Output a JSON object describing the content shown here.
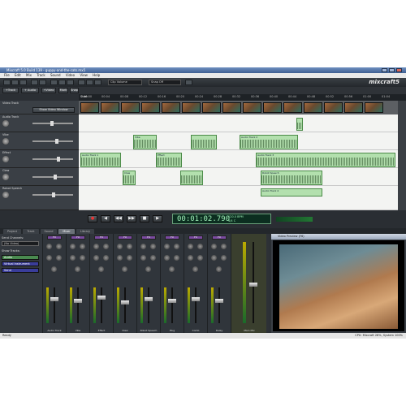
{
  "window": {
    "title": "Mixcraft 5.0 Build 139 - guppy-and-the-cats.mx5"
  },
  "menu": [
    "File",
    "Edit",
    "Mix",
    "Track",
    "Sound",
    "Video",
    "View",
    "Help"
  ],
  "toolbar": {
    "preset_combo": "Clip Volume",
    "snap_combo": "Snap Off",
    "logo": "mixcraft5"
  },
  "subtoolbar": {
    "buttons": [
      "+Track",
      "+ Audio",
      "+Video",
      "Mark",
      "Snap"
    ]
  },
  "ruler": {
    "labels": [
      "00:00",
      "00:04",
      "00:08",
      "00:12",
      "00:16",
      "00:20",
      "00:24",
      "00:28",
      "00:32",
      "00:36",
      "00:40",
      "00:44",
      "00:48",
      "00:52",
      "00:56",
      "01:00",
      "01:04"
    ],
    "marker": "Start"
  },
  "tracks": [
    {
      "name": "Video Track",
      "button": "Show Video Window"
    },
    {
      "name": "Audio Track"
    },
    {
      "name": "Vibe"
    },
    {
      "name": "Effect"
    },
    {
      "name": "Claw"
    },
    {
      "name": "Robot Speech"
    }
  ],
  "clips": [
    "Audio Track 1",
    "Effect",
    "Vibe",
    "Claw",
    "Audio Track 2",
    "Audio Track 3",
    "Robot Speech",
    "Audio Track 4"
  ],
  "transport": {
    "time": "00:01:02.790",
    "bpm": "120.0 BPM",
    "signature": "4/4 C",
    "buttons": [
      "●",
      "◀",
      "◀◀",
      "▶▶",
      "■",
      "▶"
    ]
  },
  "tabs": [
    "Project",
    "Track",
    "Sound",
    "Mixer",
    "Library"
  ],
  "mixer": {
    "send_channel_label": "Send Channels:",
    "send_channel_value": "(No Video)",
    "sends_label": "Show Tracks:",
    "buses": [
      "Audio",
      "Virtual Instrument",
      "Send"
    ],
    "strips": [
      "Audio Track",
      "Vibe",
      "Effect",
      "Claw",
      "Robot Speech",
      "Plug",
      "Comb",
      "Delay",
      "Main Mix"
    ]
  },
  "preview": {
    "title": "Video Preview (F6)"
  },
  "status": {
    "left": "Ready",
    "right": "CPU: Mixcraft 28%, System 100%"
  }
}
